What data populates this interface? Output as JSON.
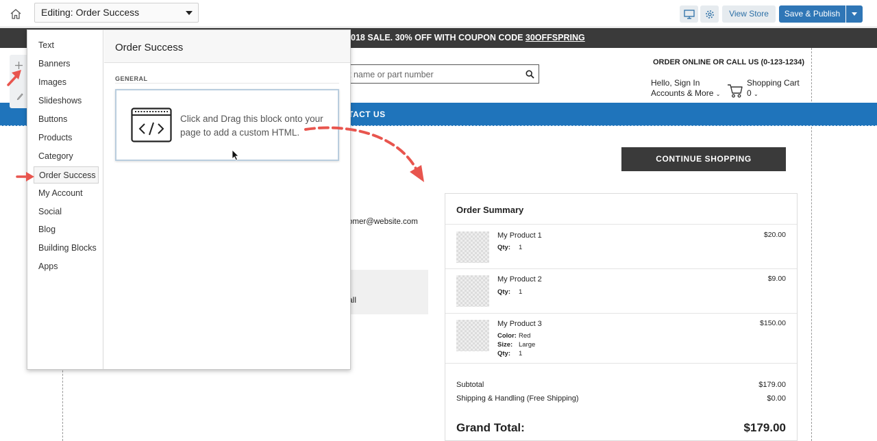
{
  "topbar": {
    "editing_label": "Editing: Order Success",
    "view_store": "View Store",
    "publish": "Save & Publish"
  },
  "store": {
    "promo_prefix": "018 SALE. 30% OFF WITH COUPON CODE ",
    "promo_code": "30OFFSPRING",
    "order_online": "ORDER ONLINE OR CALL US (0-123-1234)",
    "search_placeholder": "t name or part number",
    "account_line1": "Hello, Sign In",
    "account_line2": "Accounts & More",
    "cart_label": "Shopping Cart",
    "cart_count": "0",
    "nav_item": "TACT US",
    "continue_shopping": "CONTINUE SHOPPING",
    "email_partial": "omer@website.com",
    "grey_box_text": "all"
  },
  "summary": {
    "title": "Order Summary",
    "items": [
      {
        "name": "My Product 1",
        "price": "$20.00",
        "attrs": [
          {
            "label": "Qty:",
            "value": "1"
          }
        ]
      },
      {
        "name": "My Product 2",
        "price": "$9.00",
        "attrs": [
          {
            "label": "Qty:",
            "value": "1"
          }
        ]
      },
      {
        "name": "My Product 3",
        "price": "$150.00",
        "attrs": [
          {
            "label": "Color:",
            "value": "Red"
          },
          {
            "label": "Size:",
            "value": "Large"
          },
          {
            "label": "Qty:",
            "value": "1"
          }
        ]
      }
    ],
    "subtotal_label": "Subtotal",
    "subtotal_value": "$179.00",
    "shipping_label": "Shipping & Handling (Free Shipping)",
    "shipping_value": "$0.00",
    "grand_label": "Grand Total:",
    "grand_value": "$179.00"
  },
  "flyout": {
    "categories": [
      "Text",
      "Banners",
      "Images",
      "Slideshows",
      "Buttons",
      "Products",
      "Category",
      "Order Success",
      "My Account",
      "Social",
      "Blog",
      "Building Blocks",
      "Apps"
    ],
    "active_category": "Order Success",
    "panel_title": "Order Success",
    "section_label": "GENERAL",
    "block_text": "Click and Drag this block onto your page to add a custom HTML."
  },
  "colors": {
    "brand_blue": "#1f74bb",
    "publish_blue": "#2f76b6",
    "annotation_red": "#e8554e",
    "dark_bar": "#3a3a3a"
  },
  "icons": {
    "home": "home-icon",
    "desktop": "desktop-icon",
    "settings": "gear-icon",
    "search": "search-icon",
    "cart": "cart-icon",
    "add": "plus-icon",
    "edit": "pencil-icon",
    "html_block": "code-window-icon"
  }
}
